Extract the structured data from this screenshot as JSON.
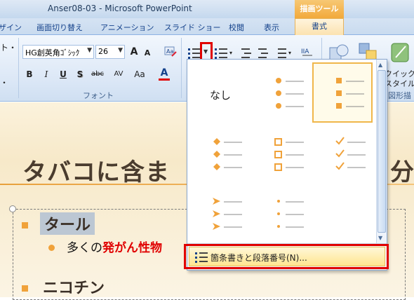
{
  "window": {
    "title": "Anser08-03  -  Microsoft PowerPoint",
    "context_title": "描画ツール"
  },
  "tabs": [
    "ザイン",
    "画面切り替え",
    "アニメーション",
    "スライド ショー",
    "校閲",
    "表示",
    "書式"
  ],
  "ribbon": {
    "left_clipped": [
      "ト・",
      "・"
    ],
    "font_name": "HG創英角ｺﾞｼｯｸ",
    "font_size": "26",
    "grow_label": "A",
    "shrink_label": "A",
    "bold": "B",
    "italic": "I",
    "underline": "U",
    "shadow": "S",
    "strikethrough": "abc",
    "spacing": "AV",
    "change_case": "Aa",
    "font_color": "A",
    "font_group_label": "フォント",
    "quick_styles": "クイック\nスタイル",
    "quick_line1": "クイック",
    "quick_line2": "スタイル ▾",
    "drawing_group_label": "図形描"
  },
  "slide": {
    "title_left": "タバコに含ま",
    "title_right": "分",
    "bullets": [
      {
        "level": 1,
        "text": "タール"
      },
      {
        "level": 2,
        "text_normal": "多くの",
        "text_red": "発がん性物"
      },
      {
        "level": 1,
        "text": "ニコチン"
      }
    ]
  },
  "gallery": {
    "none_label": "なし",
    "footer_item": "箇条書きと段落番号(N)..."
  },
  "colors": {
    "accent_orange": "#f0a23a",
    "highlight_red": "#e00000",
    "ribbon_blue": "#15428b"
  }
}
